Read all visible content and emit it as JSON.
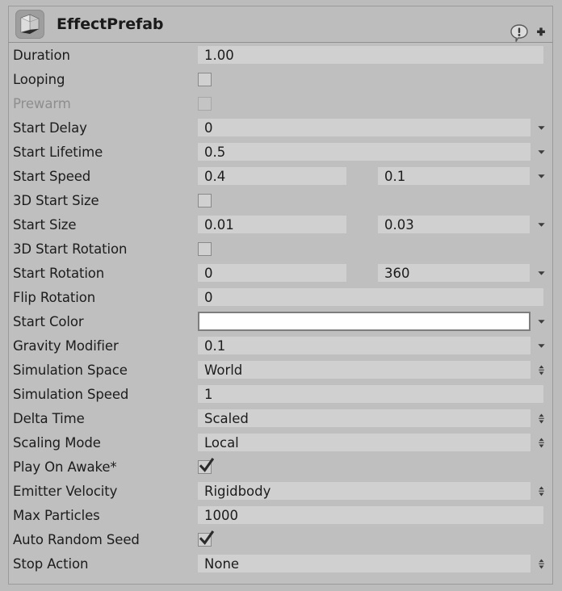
{
  "header": {
    "title": "EffectPrefab",
    "icon": "prefab-cube-icon",
    "help_icon": "help-speech-bubble-icon",
    "add_icon": "plus-icon"
  },
  "colors": {
    "panel_background": "#bcbcbc",
    "body_background": "#bfbfbf",
    "field_background": "#d0d0d0",
    "label_text": "#1c1c1c",
    "label_disabled_text": "#8e8e8e",
    "start_color_swatch": "#ffffff",
    "border": "#9a9a9a"
  },
  "rows": [
    {
      "label": "Duration",
      "type": "text",
      "value": "1.00",
      "indicator": "none"
    },
    {
      "label": "Looping",
      "type": "checkbox",
      "checked": false,
      "indicator": "none"
    },
    {
      "label": "Prewarm",
      "type": "checkbox",
      "checked": false,
      "disabled": true,
      "indicator": "none"
    },
    {
      "label": "Start Delay",
      "type": "text",
      "value": "0",
      "indicator": "caret"
    },
    {
      "label": "Start Lifetime",
      "type": "text",
      "value": "0.5",
      "indicator": "caret"
    },
    {
      "label": "Start Speed",
      "type": "pair",
      "value": "0.4",
      "value2": "0.1",
      "indicator": "caret"
    },
    {
      "label": "3D Start Size",
      "type": "checkbox",
      "checked": false,
      "indicator": "none"
    },
    {
      "label": "Start Size",
      "type": "pair",
      "value": "0.01",
      "value2": "0.03",
      "indicator": "caret"
    },
    {
      "label": "3D Start Rotation",
      "type": "checkbox",
      "checked": false,
      "indicator": "none"
    },
    {
      "label": "Start Rotation",
      "type": "pair",
      "value": "0",
      "value2": "360",
      "indicator": "caret"
    },
    {
      "label": "Flip Rotation",
      "type": "text",
      "value": "0",
      "indicator": "none"
    },
    {
      "label": "Start Color",
      "type": "color",
      "value": "#ffffff",
      "indicator": "caret"
    },
    {
      "label": "Gravity Modifier",
      "type": "text",
      "value": "0.1",
      "indicator": "caret"
    },
    {
      "label": "Simulation Space",
      "type": "popup",
      "value": "World",
      "indicator": "updown"
    },
    {
      "label": "Simulation Speed",
      "type": "text",
      "value": "1",
      "indicator": "none"
    },
    {
      "label": "Delta Time",
      "type": "popup",
      "value": "Scaled",
      "indicator": "updown"
    },
    {
      "label": "Scaling Mode",
      "type": "popup",
      "value": "Local",
      "indicator": "updown"
    },
    {
      "label": "Play On Awake*",
      "type": "checkbox",
      "checked": true,
      "indicator": "none"
    },
    {
      "label": "Emitter Velocity",
      "type": "popup",
      "value": "Rigidbody",
      "indicator": "updown"
    },
    {
      "label": "Max Particles",
      "type": "text",
      "value": "1000",
      "indicator": "none"
    },
    {
      "label": "Auto Random Seed",
      "type": "checkbox",
      "checked": true,
      "indicator": "none"
    },
    {
      "label": "Stop Action",
      "type": "popup",
      "value": "None",
      "indicator": "updown"
    }
  ]
}
